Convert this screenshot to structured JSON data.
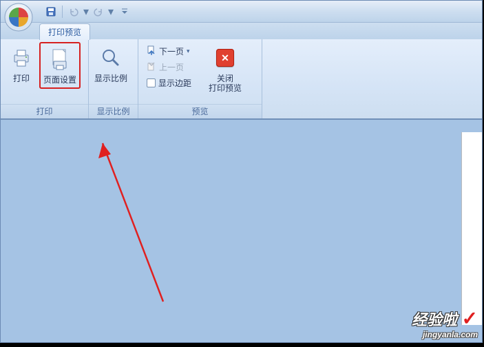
{
  "tab": {
    "label": "打印预览"
  },
  "groups": {
    "print": {
      "label": "打印",
      "print_btn": "打印",
      "page_setup_btn": "页面设置"
    },
    "zoom": {
      "label": "显示比例",
      "zoom_btn": "显示比例"
    },
    "preview": {
      "label": "预览",
      "next_page": "下一页",
      "prev_page": "上一页",
      "show_margins": "显示边距",
      "close_line1": "关闭",
      "close_line2": "打印预览"
    }
  },
  "watermark": {
    "brand": "经验啦",
    "url": "jingyanla.com"
  }
}
